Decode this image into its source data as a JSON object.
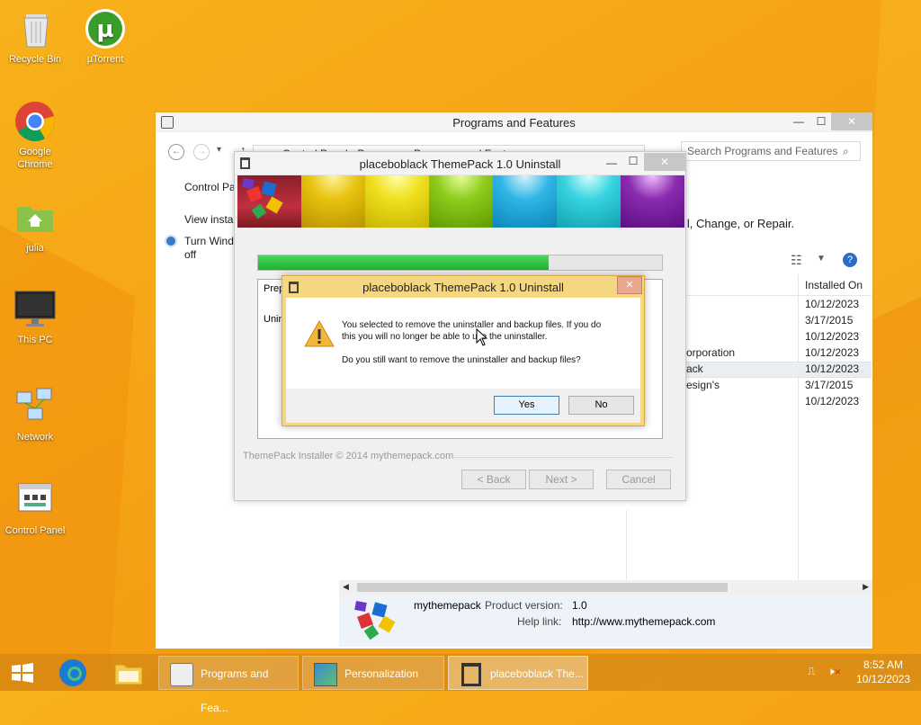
{
  "desktop": {
    "icons": [
      {
        "label": "Recycle Bin"
      },
      {
        "label": "µTorrent"
      },
      {
        "label": "Google Chrome"
      },
      {
        "label": "julia"
      },
      {
        "label": "This PC"
      },
      {
        "label": "Network"
      },
      {
        "label": "Control Panel"
      }
    ]
  },
  "programs_window": {
    "title": "Programs and Features",
    "breadcrumb": "Control Panel  ›  Programs  ›  Programs and Features",
    "search_placeholder": "Search Programs and Features",
    "left_links": [
      "Control Pa",
      "View instal",
      "Turn Wind",
      "off"
    ],
    "subtitle_partial": "ll, Change, or Repair.",
    "column_installed_on": "Installed On",
    "rows": [
      {
        "name": "",
        "installed_on": "10/12/2023"
      },
      {
        "name": "",
        "installed_on": "3/17/2015"
      },
      {
        "name": "",
        "installed_on": "10/12/2023"
      },
      {
        "name": "orporation",
        "installed_on": "10/12/2023"
      },
      {
        "name": "ack",
        "installed_on": "10/12/2023"
      },
      {
        "name": "esign's",
        "installed_on": "3/17/2015"
      },
      {
        "name": "",
        "installed_on": "10/12/2023"
      }
    ],
    "details": {
      "publisher": "mythemepack",
      "product_version_label": "Product version:",
      "product_version": "1.0",
      "help_link_label": "Help link:",
      "help_link": "http://www.mythemepack.com"
    }
  },
  "wizard_window": {
    "title": "placeboblack ThemePack 1.0 Uninstall",
    "progress_percent": 72,
    "panel_text_1": "Prep",
    "panel_text_2": "Unin",
    "footer_text": "ThemePack Installer © 2014 mythemepack.com",
    "back_label": "< Back",
    "next_label": "Next >",
    "cancel_label": "Cancel"
  },
  "message_box": {
    "title": "placeboblack ThemePack 1.0 Uninstall",
    "line1": "You selected to remove the uninstaller and backup files. If you do",
    "line2": "this you will no longer be able to use the uninstaller.",
    "line3": "Do you still want to remove the uninstaller and backup files?",
    "yes_label": "Yes",
    "no_label": "No"
  },
  "taskbar": {
    "items": [
      {
        "label": "Programs and Fea..."
      },
      {
        "label": "Personalization"
      },
      {
        "label": "placeboblack The..."
      }
    ],
    "time": "8:52 AM",
    "date": "10/12/2023"
  },
  "colors": {
    "desktop": "#f6a415",
    "progress": "#16b52d",
    "msgbox_frame": "#f6d781"
  }
}
